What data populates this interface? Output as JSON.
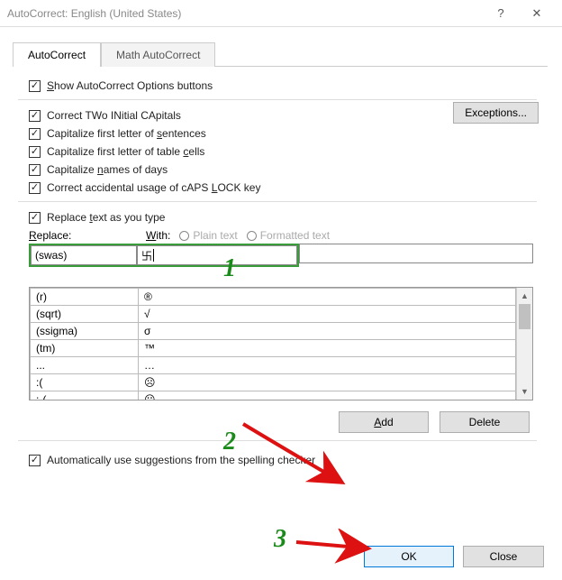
{
  "titlebar": {
    "title": "AutoCorrect: English (United States)"
  },
  "tabs": {
    "autocorrect": "AutoCorrect",
    "math": "Math AutoCorrect"
  },
  "opts": {
    "show": "Show AutoCorrect Options buttons",
    "two": "Correct TWo INitial CApitals",
    "sent": "Capitalize first letter of sentences",
    "table": "Capitalize first letter of table cells",
    "days": "Capitalize names of days",
    "caps": "Correct accidental usage of cAPS LOCK key",
    "replace": "Replace text as you type",
    "spell": "Automatically use suggestions from the spelling checker"
  },
  "labels": {
    "replace": "Replace:",
    "with": "With:",
    "plain": "Plain text",
    "formatted": "Formatted text"
  },
  "buttons": {
    "exceptions": "Exceptions...",
    "add": "Add",
    "delete": "Delete",
    "ok": "OK",
    "close": "Close"
  },
  "fields": {
    "replace": "(swas)",
    "with": "卐"
  },
  "rows": [
    {
      "k": "(r)",
      "v": "®"
    },
    {
      "k": "(sqrt)",
      "v": "√"
    },
    {
      "k": "(ssigma)",
      "v": "σ"
    },
    {
      "k": "(tm)",
      "v": "™"
    },
    {
      "k": "...",
      "v": "…"
    },
    {
      "k": ":(",
      "v": "☹"
    },
    {
      "k": ":-(",
      "v": "☹"
    }
  ],
  "anno": {
    "one": "1",
    "two": "2",
    "three": "3"
  }
}
